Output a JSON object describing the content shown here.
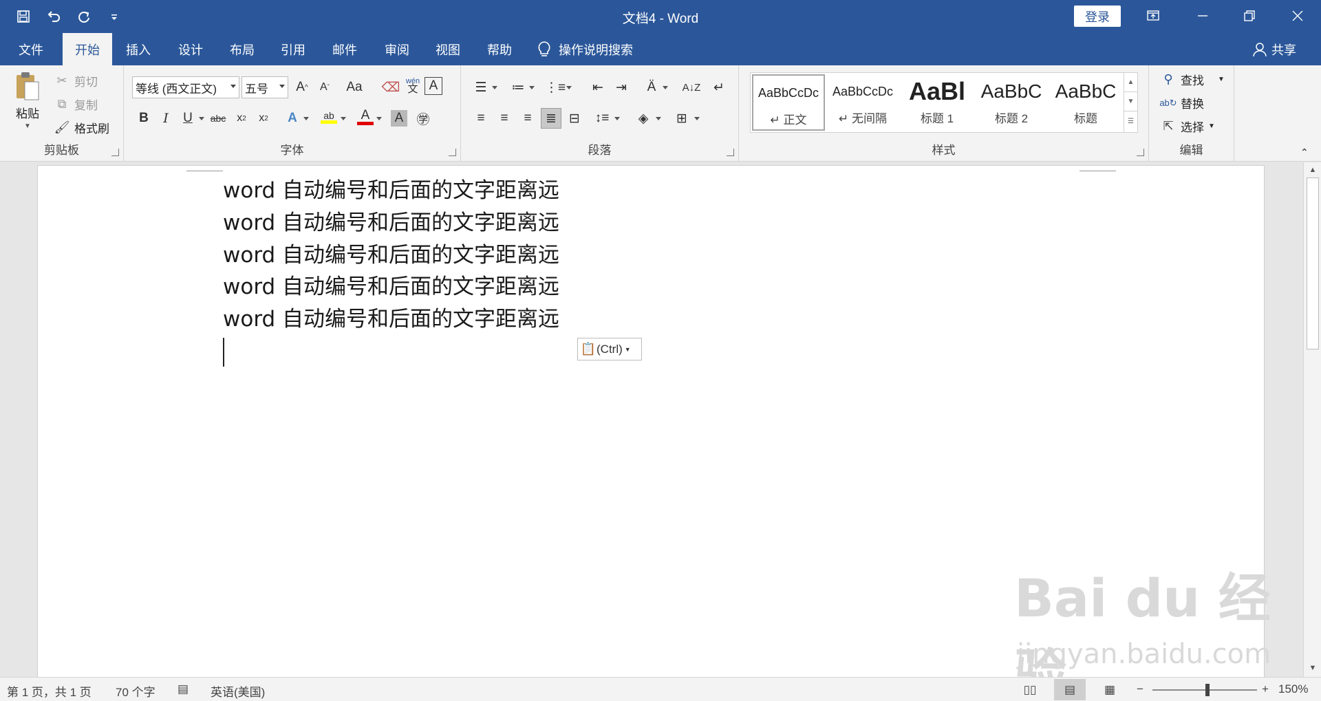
{
  "titlebar": {
    "title": "文档4  -  Word",
    "login_label": "登录",
    "colors": {
      "brand": "#2b579a"
    }
  },
  "qat": {
    "icons": [
      "save-icon",
      "undo-icon",
      "redo-icon",
      "customize-icon"
    ]
  },
  "tabs": [
    {
      "label": "文件",
      "active": false
    },
    {
      "label": "开始",
      "active": true
    },
    {
      "label": "插入",
      "active": false
    },
    {
      "label": "设计",
      "active": false
    },
    {
      "label": "布局",
      "active": false
    },
    {
      "label": "引用",
      "active": false
    },
    {
      "label": "邮件",
      "active": false
    },
    {
      "label": "审阅",
      "active": false
    },
    {
      "label": "视图",
      "active": false
    },
    {
      "label": "帮助",
      "active": false
    }
  ],
  "tellme_label": "操作说明搜索",
  "share_label": "共享",
  "clipboard": {
    "paste": "粘贴",
    "cut": "剪切",
    "copy": "复制",
    "format_painter": "格式刷",
    "group_label": "剪贴板"
  },
  "font": {
    "font_name": "等线 (西文正文)",
    "font_size": "五号",
    "group_label": "字体",
    "change_case": "Aa",
    "bold": "B",
    "italic": "I",
    "underline": "U",
    "strike": "abc",
    "wen": "wén",
    "wen_char": "文",
    "font_color_letter": "A",
    "char_border": "A"
  },
  "paragraph": {
    "group_label": "段落"
  },
  "styles": {
    "group_label": "样式",
    "items": [
      {
        "sample": "AaBbCcDc",
        "name": "↵ 正文"
      },
      {
        "sample": "AaBbCcDc",
        "name": "↵ 无间隔"
      },
      {
        "sample": "AaBl",
        "name": "标题 1"
      },
      {
        "sample": "AaBbC",
        "name": "标题 2"
      },
      {
        "sample": "AaBbC",
        "name": "标题"
      }
    ]
  },
  "editing": {
    "find": "查找",
    "replace": "替换",
    "select": "选择",
    "group_label": "编辑"
  },
  "document": {
    "lines": [
      "word 自动编号和后面的文字距离远",
      "word 自动编号和后面的文字距离远",
      "word 自动编号和后面的文字距离远",
      "word 自动编号和后面的文字距离远",
      "word 自动编号和后面的文字距离远"
    ],
    "paste_options_label": "(Ctrl)"
  },
  "watermark": {
    "text": "Bai du 经验",
    "url": "jingyan.baidu.com"
  },
  "statusbar": {
    "page": "第 1 页，共 1 页",
    "words": "70 个字",
    "language": "英语(美国)",
    "zoom": "150%",
    "zoom_minus": "−",
    "zoom_plus": "+"
  }
}
